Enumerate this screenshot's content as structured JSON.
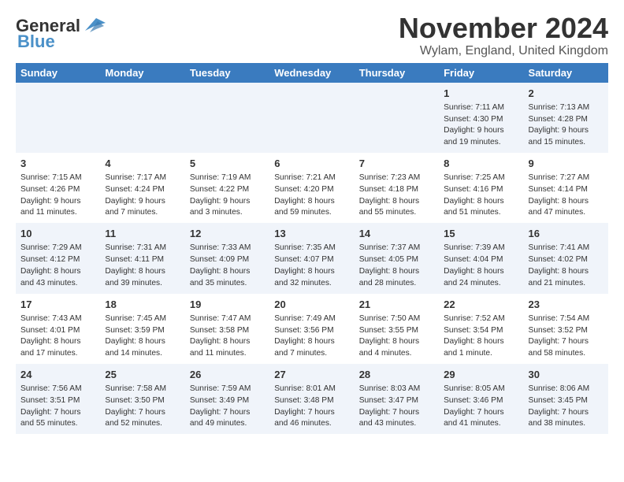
{
  "logo": {
    "part1": "General",
    "part2": "Blue"
  },
  "title": "November 2024",
  "location": "Wylam, England, United Kingdom",
  "days_of_week": [
    "Sunday",
    "Monday",
    "Tuesday",
    "Wednesday",
    "Thursday",
    "Friday",
    "Saturday"
  ],
  "weeks": [
    {
      "days": [
        {
          "num": "",
          "info": ""
        },
        {
          "num": "",
          "info": ""
        },
        {
          "num": "",
          "info": ""
        },
        {
          "num": "",
          "info": ""
        },
        {
          "num": "",
          "info": ""
        },
        {
          "num": "1",
          "info": "Sunrise: 7:11 AM\nSunset: 4:30 PM\nDaylight: 9 hours\nand 19 minutes."
        },
        {
          "num": "2",
          "info": "Sunrise: 7:13 AM\nSunset: 4:28 PM\nDaylight: 9 hours\nand 15 minutes."
        }
      ]
    },
    {
      "days": [
        {
          "num": "3",
          "info": "Sunrise: 7:15 AM\nSunset: 4:26 PM\nDaylight: 9 hours\nand 11 minutes."
        },
        {
          "num": "4",
          "info": "Sunrise: 7:17 AM\nSunset: 4:24 PM\nDaylight: 9 hours\nand 7 minutes."
        },
        {
          "num": "5",
          "info": "Sunrise: 7:19 AM\nSunset: 4:22 PM\nDaylight: 9 hours\nand 3 minutes."
        },
        {
          "num": "6",
          "info": "Sunrise: 7:21 AM\nSunset: 4:20 PM\nDaylight: 8 hours\nand 59 minutes."
        },
        {
          "num": "7",
          "info": "Sunrise: 7:23 AM\nSunset: 4:18 PM\nDaylight: 8 hours\nand 55 minutes."
        },
        {
          "num": "8",
          "info": "Sunrise: 7:25 AM\nSunset: 4:16 PM\nDaylight: 8 hours\nand 51 minutes."
        },
        {
          "num": "9",
          "info": "Sunrise: 7:27 AM\nSunset: 4:14 PM\nDaylight: 8 hours\nand 47 minutes."
        }
      ]
    },
    {
      "days": [
        {
          "num": "10",
          "info": "Sunrise: 7:29 AM\nSunset: 4:12 PM\nDaylight: 8 hours\nand 43 minutes."
        },
        {
          "num": "11",
          "info": "Sunrise: 7:31 AM\nSunset: 4:11 PM\nDaylight: 8 hours\nand 39 minutes."
        },
        {
          "num": "12",
          "info": "Sunrise: 7:33 AM\nSunset: 4:09 PM\nDaylight: 8 hours\nand 35 minutes."
        },
        {
          "num": "13",
          "info": "Sunrise: 7:35 AM\nSunset: 4:07 PM\nDaylight: 8 hours\nand 32 minutes."
        },
        {
          "num": "14",
          "info": "Sunrise: 7:37 AM\nSunset: 4:05 PM\nDaylight: 8 hours\nand 28 minutes."
        },
        {
          "num": "15",
          "info": "Sunrise: 7:39 AM\nSunset: 4:04 PM\nDaylight: 8 hours\nand 24 minutes."
        },
        {
          "num": "16",
          "info": "Sunrise: 7:41 AM\nSunset: 4:02 PM\nDaylight: 8 hours\nand 21 minutes."
        }
      ]
    },
    {
      "days": [
        {
          "num": "17",
          "info": "Sunrise: 7:43 AM\nSunset: 4:01 PM\nDaylight: 8 hours\nand 17 minutes."
        },
        {
          "num": "18",
          "info": "Sunrise: 7:45 AM\nSunset: 3:59 PM\nDaylight: 8 hours\nand 14 minutes."
        },
        {
          "num": "19",
          "info": "Sunrise: 7:47 AM\nSunset: 3:58 PM\nDaylight: 8 hours\nand 11 minutes."
        },
        {
          "num": "20",
          "info": "Sunrise: 7:49 AM\nSunset: 3:56 PM\nDaylight: 8 hours\nand 7 minutes."
        },
        {
          "num": "21",
          "info": "Sunrise: 7:50 AM\nSunset: 3:55 PM\nDaylight: 8 hours\nand 4 minutes."
        },
        {
          "num": "22",
          "info": "Sunrise: 7:52 AM\nSunset: 3:54 PM\nDaylight: 8 hours\nand 1 minute."
        },
        {
          "num": "23",
          "info": "Sunrise: 7:54 AM\nSunset: 3:52 PM\nDaylight: 7 hours\nand 58 minutes."
        }
      ]
    },
    {
      "days": [
        {
          "num": "24",
          "info": "Sunrise: 7:56 AM\nSunset: 3:51 PM\nDaylight: 7 hours\nand 55 minutes."
        },
        {
          "num": "25",
          "info": "Sunrise: 7:58 AM\nSunset: 3:50 PM\nDaylight: 7 hours\nand 52 minutes."
        },
        {
          "num": "26",
          "info": "Sunrise: 7:59 AM\nSunset: 3:49 PM\nDaylight: 7 hours\nand 49 minutes."
        },
        {
          "num": "27",
          "info": "Sunrise: 8:01 AM\nSunset: 3:48 PM\nDaylight: 7 hours\nand 46 minutes."
        },
        {
          "num": "28",
          "info": "Sunrise: 8:03 AM\nSunset: 3:47 PM\nDaylight: 7 hours\nand 43 minutes."
        },
        {
          "num": "29",
          "info": "Sunrise: 8:05 AM\nSunset: 3:46 PM\nDaylight: 7 hours\nand 41 minutes."
        },
        {
          "num": "30",
          "info": "Sunrise: 8:06 AM\nSunset: 3:45 PM\nDaylight: 7 hours\nand 38 minutes."
        }
      ]
    }
  ]
}
